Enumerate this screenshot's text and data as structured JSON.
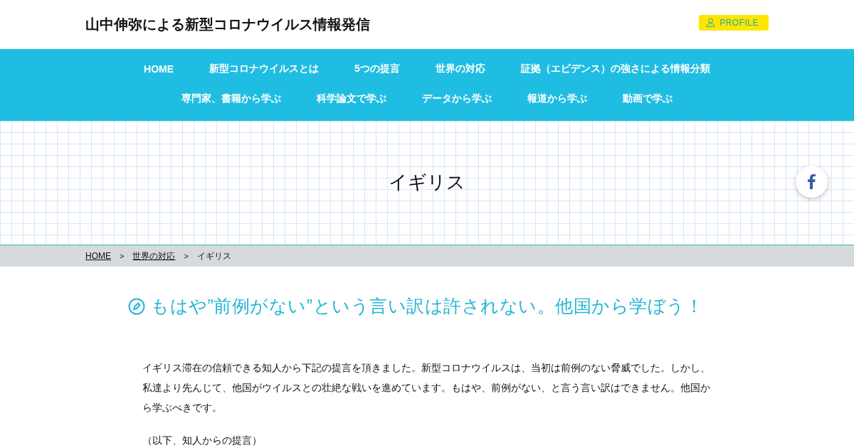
{
  "site": {
    "title": "山中伸弥による新型コロナウイルス情報発信",
    "profile_button": "PROFILE"
  },
  "nav": {
    "items": [
      "HOME",
      "新型コロナウイルスとは",
      "5つの提言",
      "世界の対応",
      "証拠（エビデンス）の強さによる情報分類",
      "専門家、書籍から学ぶ",
      "科学論文で学ぶ",
      "データから学ぶ",
      "報道から学ぶ",
      "動画で学ぶ"
    ]
  },
  "hero": {
    "title": "イギリス"
  },
  "breadcrumb": [
    {
      "label": "HOME",
      "kind": "link"
    },
    {
      "label": ">",
      "kind": "separator"
    },
    {
      "label": "世界の対応",
      "kind": "link"
    },
    {
      "label": ">",
      "kind": "separator"
    },
    {
      "label": "イギリス",
      "kind": "current"
    }
  ],
  "article": {
    "heading": "もはや”前例がない”という言い訳は許されない。他国から学ぼう！",
    "paragraphs": [
      "イギリス滞在の信頼できる知人から下記の提言を頂きました。新型コロナウイルスは、当初は前例のない脅威でした。しかし、私達より先んじて、他国がウイルスとの壮絶な戦いを進めています。もはや、前例がない、と言う言い訳はできません。他国から学ぶべきです。",
      "（以下、知人からの提言）"
    ]
  }
}
